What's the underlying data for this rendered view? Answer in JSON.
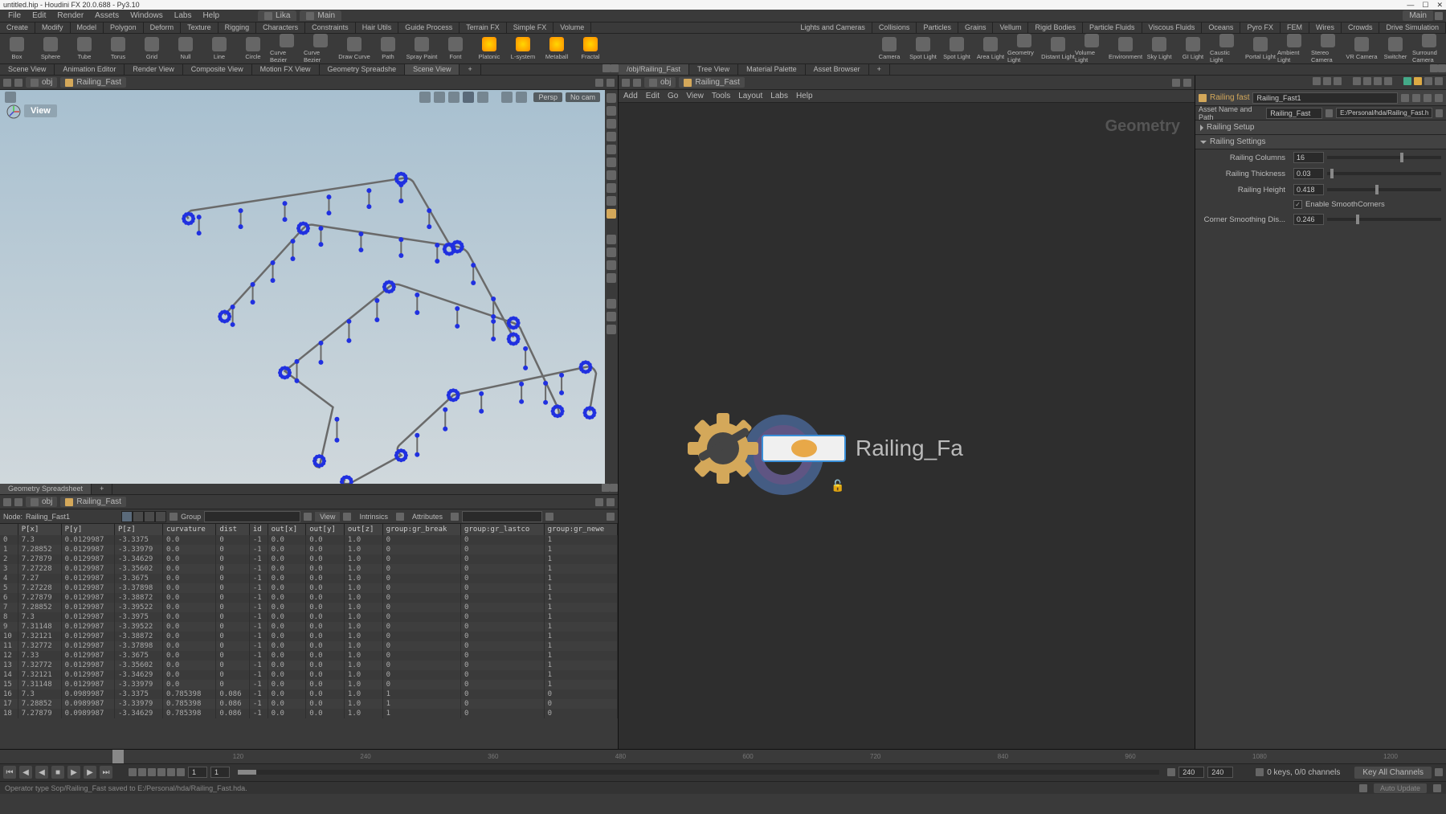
{
  "title_bar": {
    "title": "untitled.hip - Houdini FX 20.0.688 - Py3.10",
    "right_label": "Main"
  },
  "menubar": {
    "items": [
      "File",
      "Edit",
      "Render",
      "Assets",
      "Windows",
      "Labs",
      "Help"
    ],
    "desktops": [
      "Lika",
      "Main"
    ]
  },
  "shelf_tabs_left": [
    "Create",
    "Modify",
    "Model",
    "Polygon",
    "Deform",
    "Texture",
    "Rigging",
    "Characters",
    "Constraints",
    "Hair Utils",
    "Guide Process",
    "Terrain FX",
    "Simple FX",
    "Volume"
  ],
  "shelf_tabs_right": [
    "Lights and Cameras",
    "Collisions",
    "Particles",
    "Grains",
    "Vellum",
    "Rigid Bodies",
    "Particle Fluids",
    "Viscous Fluids",
    "Oceans",
    "Pyro FX",
    "FEM",
    "Wires",
    "Crowds",
    "Drive Simulation"
  ],
  "shelf_items_left": [
    "Box",
    "Sphere",
    "Tube",
    "Torus",
    "Grid",
    "Null",
    "Line",
    "Circle",
    "Curve Bezier",
    "Curve Bezier",
    "Draw Curve",
    "Path",
    "Spray Paint",
    "Font",
    "Platonic",
    "L-system",
    "Metaball",
    "Fractal"
  ],
  "shelf_items_right": [
    "Camera",
    "Spot Light",
    "Spot Light",
    "Area Light",
    "Geometry Light",
    "Distant Light",
    "Volume Light",
    "Environment",
    "Sky Light",
    "GI Light",
    "Caustic Light",
    "Portal Light",
    "Ambient Light",
    "Stereo Camera",
    "VR Camera",
    "Switcher",
    "Surround Camera"
  ],
  "pane_tabs_left": [
    "Scene View",
    "Animation Editor",
    "Render View",
    "Composite View",
    "Motion FX View",
    "Geometry Spreadshe",
    "Scene View"
  ],
  "pane_tabs_right_top": [
    "/obj/Railing_Fast",
    "Tree View",
    "Material Palette",
    "Asset Browser"
  ],
  "breadcrumb": {
    "level1": "obj",
    "level2": "Railing_Fast"
  },
  "viewport": {
    "label": "View",
    "persp_btn": "Persp",
    "nocam_btn": "No cam"
  },
  "network": {
    "menus": [
      "Add",
      "Edit",
      "Go",
      "View",
      "Tools",
      "Layout",
      "Labs",
      "Help"
    ],
    "watermark": "Geometry",
    "node_label": "Railing_Fa"
  },
  "params": {
    "type_label": "Railing fast",
    "type_value": "Railing_Fast1",
    "asset_label": "Asset Name and Path",
    "asset_name": "Railing_Fast",
    "asset_path": "E:/Personal/hda/Railing_Fast.hda",
    "groups": {
      "setup": "Railing Setup",
      "settings": "Railing Settings"
    },
    "items": {
      "columns": {
        "label": "Railing Columns",
        "value": "16",
        "slider_pct": 64
      },
      "thickness": {
        "label": "Railing Thickness",
        "value": "0.03",
        "slider_pct": 3
      },
      "height": {
        "label": "Railing Height",
        "value": "0.418",
        "slider_pct": 42
      },
      "smooth": {
        "label": "Enable SmoothCorners",
        "checked": true
      },
      "smoothdist": {
        "label": "Corner Smoothing Dis...",
        "value": "0.246",
        "slider_pct": 25
      }
    }
  },
  "spreadsheet": {
    "tab": "Geometry Spreadsheet",
    "node_label": "Node:",
    "node_value": "Railing_Fast1",
    "group_label": "Group",
    "view_btn": "View",
    "intrinsics_btn": "Intrinsics",
    "attributes_btn": "Attributes",
    "columns": [
      "",
      "P[x]",
      "P[y]",
      "P[z]",
      "curvature",
      "dist",
      "id",
      "out[x]",
      "out[y]",
      "out[z]",
      "group:gr_break",
      "group:gr_lastco",
      "group:gr_newe"
    ],
    "rows": [
      [
        "0",
        "7.3",
        "0.0129987",
        "-3.3375",
        "0.0",
        "0",
        "-1",
        "0.0",
        "0.0",
        "1.0",
        "0",
        "0",
        "1"
      ],
      [
        "1",
        "7.28852",
        "0.0129987",
        "-3.33979",
        "0.0",
        "0",
        "-1",
        "0.0",
        "0.0",
        "1.0",
        "0",
        "0",
        "1"
      ],
      [
        "2",
        "7.27879",
        "0.0129987",
        "-3.34629",
        "0.0",
        "0",
        "-1",
        "0.0",
        "0.0",
        "1.0",
        "0",
        "0",
        "1"
      ],
      [
        "3",
        "7.27228",
        "0.0129987",
        "-3.35602",
        "0.0",
        "0",
        "-1",
        "0.0",
        "0.0",
        "1.0",
        "0",
        "0",
        "1"
      ],
      [
        "4",
        "7.27",
        "0.0129987",
        "-3.3675",
        "0.0",
        "0",
        "-1",
        "0.0",
        "0.0",
        "1.0",
        "0",
        "0",
        "1"
      ],
      [
        "5",
        "7.27228",
        "0.0129987",
        "-3.37898",
        "0.0",
        "0",
        "-1",
        "0.0",
        "0.0",
        "1.0",
        "0",
        "0",
        "1"
      ],
      [
        "6",
        "7.27879",
        "0.0129987",
        "-3.38872",
        "0.0",
        "0",
        "-1",
        "0.0",
        "0.0",
        "1.0",
        "0",
        "0",
        "1"
      ],
      [
        "7",
        "7.28852",
        "0.0129987",
        "-3.39522",
        "0.0",
        "0",
        "-1",
        "0.0",
        "0.0",
        "1.0",
        "0",
        "0",
        "1"
      ],
      [
        "8",
        "7.3",
        "0.0129987",
        "-3.3975",
        "0.0",
        "0",
        "-1",
        "0.0",
        "0.0",
        "1.0",
        "0",
        "0",
        "1"
      ],
      [
        "9",
        "7.31148",
        "0.0129987",
        "-3.39522",
        "0.0",
        "0",
        "-1",
        "0.0",
        "0.0",
        "1.0",
        "0",
        "0",
        "1"
      ],
      [
        "10",
        "7.32121",
        "0.0129987",
        "-3.38872",
        "0.0",
        "0",
        "-1",
        "0.0",
        "0.0",
        "1.0",
        "0",
        "0",
        "1"
      ],
      [
        "11",
        "7.32772",
        "0.0129987",
        "-3.37898",
        "0.0",
        "0",
        "-1",
        "0.0",
        "0.0",
        "1.0",
        "0",
        "0",
        "1"
      ],
      [
        "12",
        "7.33",
        "0.0129987",
        "-3.3675",
        "0.0",
        "0",
        "-1",
        "0.0",
        "0.0",
        "1.0",
        "0",
        "0",
        "1"
      ],
      [
        "13",
        "7.32772",
        "0.0129987",
        "-3.35602",
        "0.0",
        "0",
        "-1",
        "0.0",
        "0.0",
        "1.0",
        "0",
        "0",
        "1"
      ],
      [
        "14",
        "7.32121",
        "0.0129987",
        "-3.34629",
        "0.0",
        "0",
        "-1",
        "0.0",
        "0.0",
        "1.0",
        "0",
        "0",
        "1"
      ],
      [
        "15",
        "7.31148",
        "0.0129987",
        "-3.33979",
        "0.0",
        "0",
        "-1",
        "0.0",
        "0.0",
        "1.0",
        "0",
        "0",
        "1"
      ],
      [
        "16",
        "7.3",
        "0.0989987",
        "-3.3375",
        "0.785398",
        "0.086",
        "-1",
        "0.0",
        "0.0",
        "1.0",
        "1",
        "0",
        "0"
      ],
      [
        "17",
        "7.28852",
        "0.0989987",
        "-3.33979",
        "0.785398",
        "0.086",
        "-1",
        "0.0",
        "0.0",
        "1.0",
        "1",
        "0",
        "0"
      ],
      [
        "18",
        "7.27879",
        "0.0989987",
        "-3.34629",
        "0.785398",
        "0.086",
        "-1",
        "0.0",
        "0.0",
        "1.0",
        "1",
        "0",
        "0"
      ]
    ]
  },
  "timeline": {
    "frame": "1",
    "end": "240",
    "end2": "240",
    "aux1": "1",
    "aux2": "1",
    "keys_label": "0 keys, 0/0 channels",
    "key_all": "Key All Channels",
    "auto_update": "Auto Update"
  },
  "status": "Operator type Sop/Railing_Fast saved to E:/Personal/hda/Railing_Fast.hda."
}
